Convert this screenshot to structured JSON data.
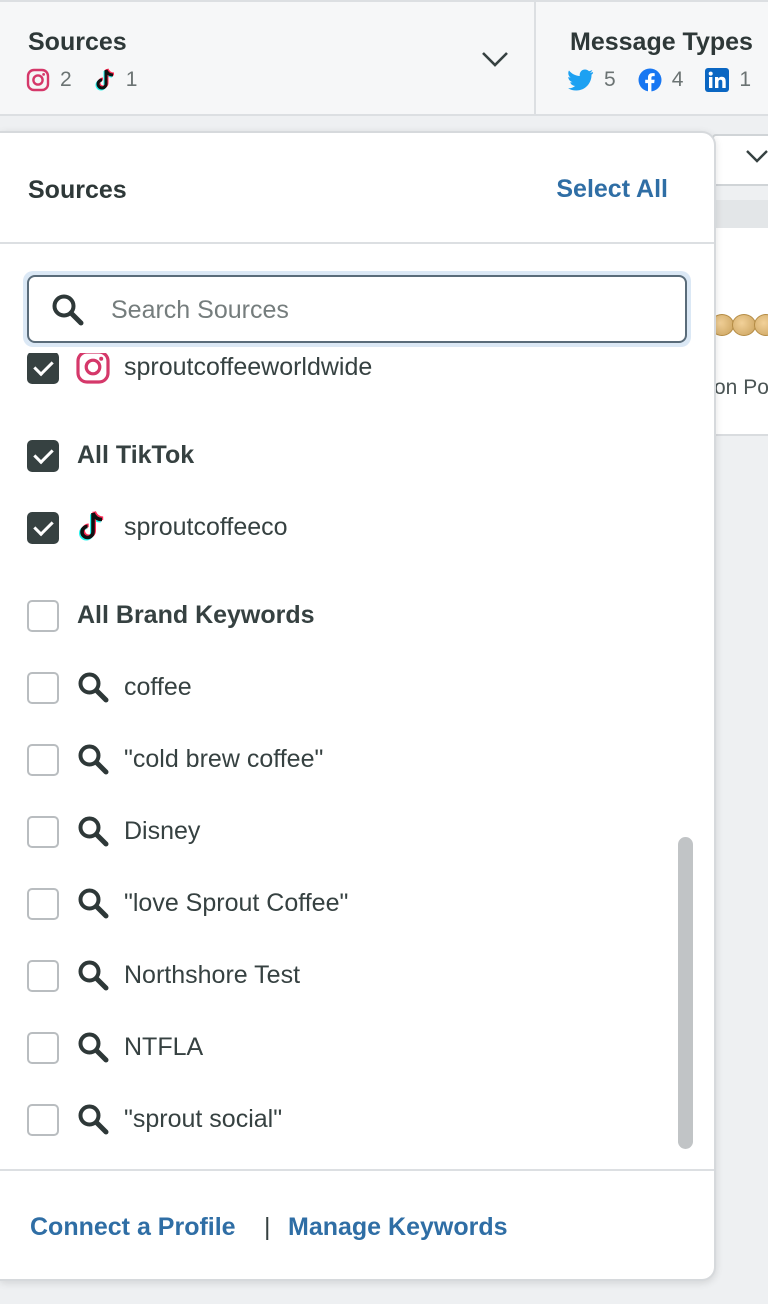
{
  "topbar": {
    "sources_filter": {
      "title": "Sources",
      "counts": [
        {
          "icon": "instagram-icon",
          "count": "2"
        },
        {
          "icon": "tiktok-icon",
          "count": "1"
        }
      ]
    },
    "message_types_filter": {
      "title": "Message Types",
      "counts": [
        {
          "icon": "twitter-icon",
          "count": "5"
        },
        {
          "icon": "facebook-icon",
          "count": "4"
        },
        {
          "icon": "linkedin-icon",
          "count": "1"
        }
      ]
    }
  },
  "background": {
    "partial_text": "on Po"
  },
  "dropdown": {
    "title": "Sources",
    "select_all": "Select All",
    "search": {
      "placeholder": "Search Sources",
      "value": ""
    },
    "items": [
      {
        "label": "sproutcoffeeworldwide",
        "type": "profile",
        "icon": "instagram-icon",
        "checked": true
      },
      {
        "label": "All TikTok",
        "type": "group",
        "checked": true
      },
      {
        "label": "sproutcoffeeco",
        "type": "profile",
        "icon": "tiktok-icon",
        "checked": true
      },
      {
        "label": "All Brand Keywords",
        "type": "group",
        "checked": false
      },
      {
        "label": "coffee",
        "type": "keyword",
        "icon": "search-icon",
        "checked": false
      },
      {
        "label": "\"cold brew coffee\"",
        "type": "keyword",
        "icon": "search-icon",
        "checked": false
      },
      {
        "label": "Disney",
        "type": "keyword",
        "icon": "search-icon",
        "checked": false
      },
      {
        "label": "\"love Sprout Coffee\"",
        "type": "keyword",
        "icon": "search-icon",
        "checked": false
      },
      {
        "label": "Northshore Test",
        "type": "keyword",
        "icon": "search-icon",
        "checked": false
      },
      {
        "label": "NTFLA",
        "type": "keyword",
        "icon": "search-icon",
        "checked": false
      },
      {
        "label": "\"sprout social\"",
        "type": "keyword",
        "icon": "search-icon",
        "checked": false
      }
    ],
    "footer": {
      "connect_profile": "Connect a Profile",
      "separator": "|",
      "manage_keywords": "Manage Keywords"
    }
  },
  "colors": {
    "link": "#2f6ea5",
    "checked": "#364141",
    "instagram": "#d5386a",
    "twitter": "#1da1f2",
    "facebook": "#1877f2",
    "linkedin": "#0a66c2"
  }
}
